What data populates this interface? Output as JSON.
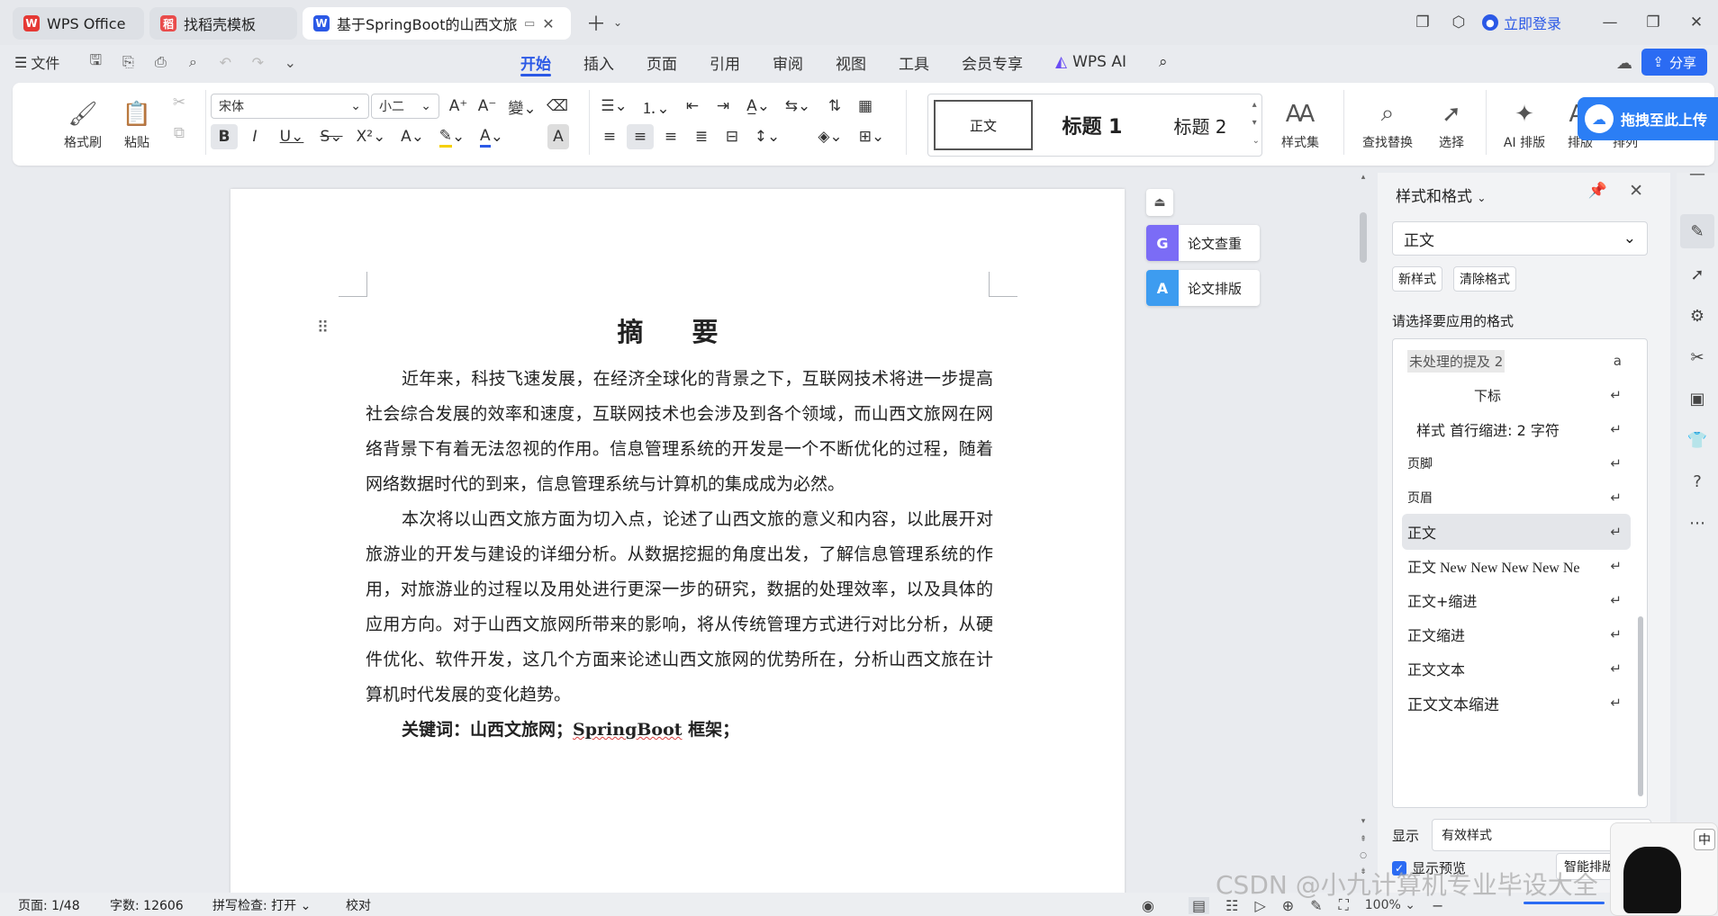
{
  "tabs": [
    {
      "label": "WPS Office",
      "icon": "wps-logo-icon"
    },
    {
      "label": "找稻壳模板",
      "icon": "docer-icon"
    },
    {
      "label": "基于SpringBoot的山西文旅网",
      "icon": "word-doc-icon"
    }
  ],
  "titlebar": {
    "login": "立即登录"
  },
  "menu": {
    "file": "文件",
    "tabs": [
      "开始",
      "插入",
      "页面",
      "引用",
      "审阅",
      "视图",
      "工具",
      "会员专享"
    ],
    "ai": "WPS AI",
    "share": "分享"
  },
  "ribbon": {
    "format_painter": "格式刷",
    "paste": "粘贴",
    "font_name": "宋体",
    "font_size": "小二",
    "styles": [
      "正文",
      "标题 1",
      "标题 2"
    ],
    "style_set": "样式集",
    "find_replace": "查找替换",
    "select": "选择",
    "ai_layout": "AI 排版",
    "layout": "排版",
    "arrange": "排列",
    "drag_upload": "拖拽至此上传"
  },
  "document": {
    "title": "摘 要",
    "paragraphs": [
      "近年来，科技飞速发展，在经济全球化的背景之下，互联网技术将进一步提高社会综合发展的效率和速度，互联网技术也会涉及到各个领域，而山西文旅网在网络背景下有着无法忽视的作用。信息管理系统的开发是一个不断优化的过程，随着网络数据时代的到来，信息管理系统与计算机的集成成为必然。",
      "本次将以山西文旅方面为切入点，论述了山西文旅的意义和内容，以此展开对旅游业的开发与建设的详细分析。从数据挖掘的角度出发，了解信息管理系统的作用，对旅游业的过程以及用处进行更深一步的研究，数据的处理效率，以及具体的应用方向。对于山西文旅网所带来的影响，将从传统管理方式进行对比分析，从硬件优化、软件开发，这几个方面来论述山西文旅网的优势所在，分析山西文旅在计算机时代发展的变化趋势。"
    ],
    "keywords_prefix": "关键词：山西文旅网；",
    "keywords_springboot": "SpringBoot",
    "keywords_suffix": " 框架；"
  },
  "float_buttons": {
    "check": "论文查重",
    "layout": "论文排版"
  },
  "panel": {
    "title": "样式和格式",
    "current_style": "正文",
    "new_style": "新样式",
    "clear_format": "清除格式",
    "choose_label": "请选择要应用的格式",
    "items": [
      "未处理的提及 2",
      "下标",
      "样式 首行缩进:   2 字符",
      "页脚",
      "页眉",
      "正文",
      "正文 New New New New Ne",
      "正文+缩进",
      "正文缩进",
      "正文文本",
      "正文文本缩进"
    ],
    "show_label": "显示",
    "show_value": "有效样式",
    "preview_label": "显示预览",
    "smart_button": "智能排版"
  },
  "status": {
    "page": "页面: 1/48",
    "words": "字数: 12606",
    "spell": "拼写检查: 打开",
    "proof": "校对",
    "zoom": "100%"
  },
  "watermark": "CSDN @小九计算机专业毕设大全",
  "ime": "中",
  "colors": {
    "accent": "#2b59e6",
    "share": "#2b6bf3",
    "upload": "#2b7ef5",
    "wps_red": "#e53935"
  }
}
